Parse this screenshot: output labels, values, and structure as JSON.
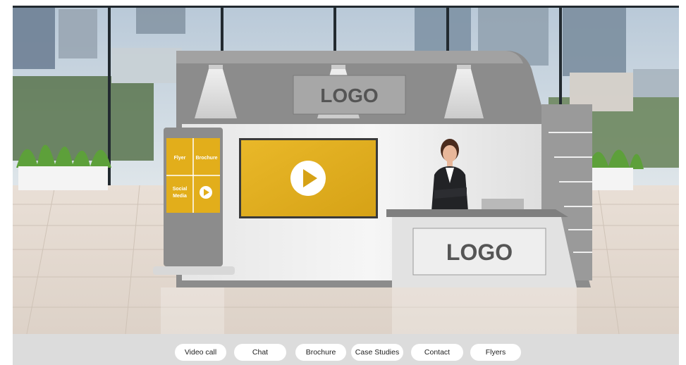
{
  "booth": {
    "header_logo": "LOGO",
    "counter_logo": "LOGO"
  },
  "kiosk": {
    "flyer": "Flyer",
    "brochure": "Brochure",
    "social_media_line1": "Social",
    "social_media_line2": "Media"
  },
  "toolbar": {
    "video_call": "Video call",
    "chat": "Chat",
    "brochure": "Brochure",
    "case_studies": "Case Studies",
    "contact": "Contact",
    "flyers": "Flyers"
  },
  "colors": {
    "accent": "#E2AE1B",
    "booth_gray": "#8C8C8C",
    "toolbar_bg": "#DCDCDC"
  }
}
